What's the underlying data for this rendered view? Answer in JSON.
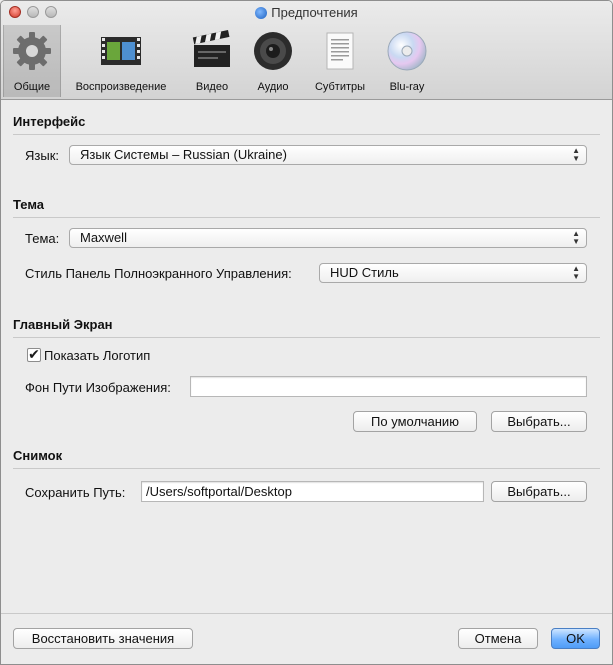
{
  "window": {
    "title": "Предпочтения"
  },
  "toolbar": {
    "items": [
      {
        "label": "Общие",
        "icon": "gear-icon",
        "active": true
      },
      {
        "label": "Воспроизведение",
        "icon": "filmstrip-icon",
        "active": false
      },
      {
        "label": "Видео",
        "icon": "clapperboard-icon",
        "active": false
      },
      {
        "label": "Аудио",
        "icon": "speaker-icon",
        "active": false
      },
      {
        "label": "Субтитры",
        "icon": "document-icon",
        "active": false
      },
      {
        "label": "Blu-ray",
        "icon": "disc-icon",
        "active": false
      }
    ]
  },
  "interface": {
    "heading": "Интерфейс",
    "language_label": "Язык:",
    "language_value": "Язык Системы – Russian (Ukraine)"
  },
  "theme": {
    "heading": "Тема",
    "theme_label": "Тема:",
    "theme_value": "Maxwell",
    "fullscreen_label": "Стиль Панель Полноэкранного Управления:",
    "fullscreen_value": "HUD Стиль"
  },
  "main_screen": {
    "heading": "Главный Экран",
    "show_logo_label": "Показать Логотип",
    "show_logo_checked": true,
    "bg_path_label": "Фон Пути Изображения:",
    "bg_path_value": "",
    "default_button": "По умолчанию",
    "choose_button": "Выбрать..."
  },
  "snapshot": {
    "heading": "Снимок",
    "save_path_label": "Сохранить Путь:",
    "save_path_value": "/Users/softportal/Desktop",
    "choose_button": "Выбрать..."
  },
  "footer": {
    "restore_button": "Восстановить значения",
    "cancel_button": "Отмена",
    "ok_button": "OK"
  },
  "colors": {
    "accent": "#5aa5fb",
    "background": "#ececec"
  }
}
